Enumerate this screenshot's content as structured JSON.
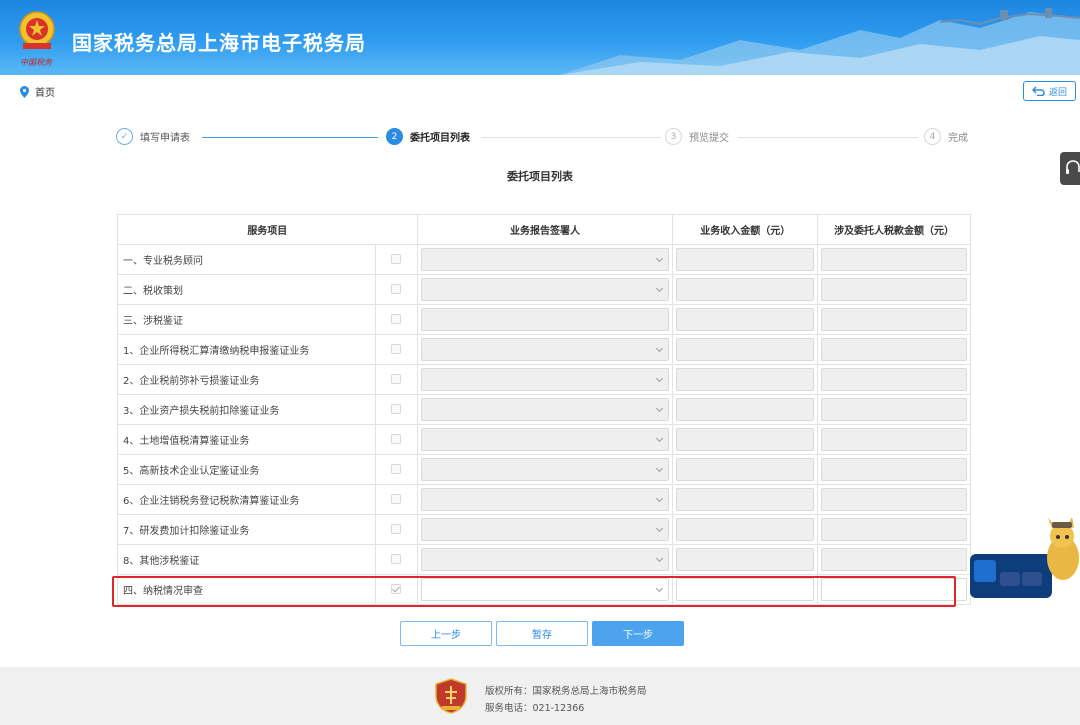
{
  "header": {
    "title": "国家税务总局上海市电子税务局",
    "slogan": "中国税务"
  },
  "breadcrumb": {
    "home": "首页"
  },
  "back_button": {
    "label": "返回"
  },
  "steps": [
    {
      "index": "✓",
      "label": "填写申请表",
      "state": "done"
    },
    {
      "index": "2",
      "label": "委托项目列表",
      "state": "active"
    },
    {
      "index": "3",
      "label": "预览提交",
      "state": "todo"
    },
    {
      "index": "4",
      "label": "完成",
      "state": "todo"
    }
  ],
  "section_title": "委托项目列表",
  "table": {
    "headers": [
      "服务项目",
      "业务报告签署人",
      "业务收入金额（元）",
      "涉及委托人税款金额（元）"
    ],
    "rows": [
      {
        "name": "一、专业税务顾问",
        "checked": false
      },
      {
        "name": "二、税收策划",
        "checked": false
      },
      {
        "name": "三、涉税鉴证",
        "checked": false
      },
      {
        "name": "1、企业所得税汇算清缴纳税申报鉴证业务",
        "checked": false
      },
      {
        "name": "2、企业税前弥补亏损鉴证业务",
        "checked": false
      },
      {
        "name": "3、企业资产损失税前扣除鉴证业务",
        "checked": false
      },
      {
        "name": "4、土地增值税清算鉴证业务",
        "checked": false
      },
      {
        "name": "5、高新技术企业认定鉴证业务",
        "checked": false
      },
      {
        "name": "6、企业注销税务登记税款清算鉴证业务",
        "checked": false
      },
      {
        "name": "7、研发费加计扣除鉴证业务",
        "checked": false
      },
      {
        "name": "8、其他涉税鉴证",
        "checked": false
      },
      {
        "name": "四、纳税情况审查",
        "checked": true
      }
    ]
  },
  "buttons": {
    "prev": "上一步",
    "save": "暂存",
    "next": "下一步"
  },
  "footer": {
    "copyright": "版权所有：国家税务总局上海市税务局",
    "phone": "服务电话：021-12366"
  },
  "colors": {
    "primary": "#2a8be3",
    "highlight": "#e0252b",
    "header": "#2f9cf0"
  }
}
